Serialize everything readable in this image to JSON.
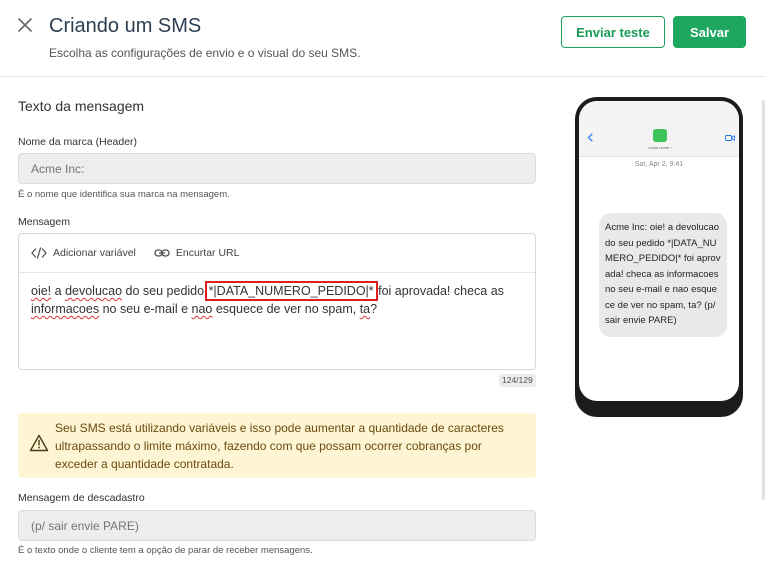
{
  "header": {
    "title": "Criando um SMS",
    "subtitle": "Escolha as configurações de envio e o visual do seu SMS.",
    "send_test_label": "Enviar teste",
    "save_label": "Salvar"
  },
  "form": {
    "section_title": "Texto da mensagem",
    "brand": {
      "label": "Nome da marca (Header)",
      "placeholder": "Acme Inc:",
      "helper": "É o nome que identifica sua marca na mensagem."
    },
    "message": {
      "label": "Mensagem",
      "add_variable_label": "Adicionar variável",
      "shorten_url_label": "Encurtar URL",
      "text": {
        "w_oie": "oie!",
        "p1": " a ",
        "w_devolucao": "devolucao",
        "p2": " do seu pedido ",
        "variable": "*|DATA_NUMERO_PEDIDO|*",
        "p3": " foi aprovada! checa as ",
        "w_informacoes": "informacoes",
        "p4": " no seu e-mail e ",
        "w_nao": "nao",
        "p5": " esquece de ver no spam, ",
        "w_ta": "ta",
        "p6": "?"
      },
      "counter": "124/129"
    },
    "alert": {
      "text": "Seu SMS está utilizando variáveis e isso pode aumentar a quantidade de caracteres ultrapassando o limite máximo, fazendo com que possam ocorrer cobranças por exceder a quantidade contratada."
    },
    "unsubscribe": {
      "label": "Mensagem de descadastro",
      "placeholder": "(p/ sair envie PARE)",
      "helper": "É o texto onde o cliente tem a opção de parar de receber mensagens."
    }
  },
  "preview": {
    "contact_name": "conta.nome ›",
    "date": "Sat, Apr 2, 9:41",
    "bubble_text": "Acme Inc: oie! a devolucao do seu pedido *|DATA_NUMERO_PEDIDO|* foi aprovada! checa as informacoes no seu e-mail e nao esquece de ver no spam, ta? (p/ sair envie PARE)"
  },
  "colors": {
    "primary_green": "#1ea75f",
    "alert_bg": "#fdf5d3",
    "variable_highlight": "#e01e1e"
  },
  "icons": {
    "close": "close-icon",
    "code": "code-icon",
    "link": "link-icon",
    "warning": "warning-icon"
  }
}
